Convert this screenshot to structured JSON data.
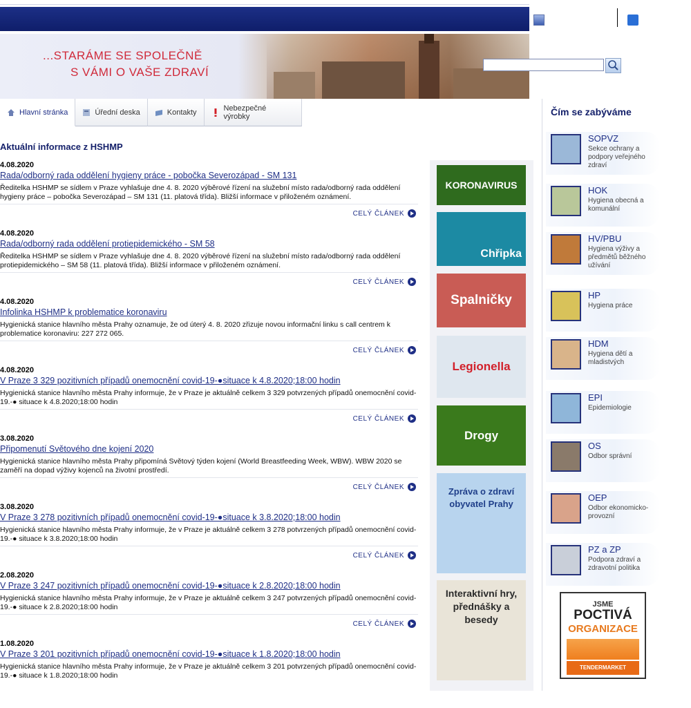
{
  "header": {
    "slogan_line1": "...STARÁME SE SPOLEČNĚ",
    "slogan_line2": "S VÁMI O VAŠE ZDRAVÍ",
    "search_value": "",
    "rss_glyph": "RSS"
  },
  "tabs": [
    {
      "label": "Hlavní stránka",
      "icon": "home-icon",
      "active": true
    },
    {
      "label": "Úřední deska",
      "icon": "board-icon",
      "active": false
    },
    {
      "label": "Kontakty",
      "icon": "contacts-icon",
      "active": false
    },
    {
      "label": "Nebezpečné výrobky",
      "icon": "warning-icon",
      "active": false
    }
  ],
  "main": {
    "section_title": "Aktuální informace z HSHMP",
    "more_label": "CELÝ ČLÁNEK",
    "news": [
      {
        "date": "4.08.2020",
        "title": "Rada/odborný rada oddělení hygieny práce - pobočka Severozápad - SM 131",
        "desc": "Ředitelka HSHMP se sídlem v Praze vyhlašuje dne 4. 8. 2020 výběrové řízení na služební místo rada/odborný rada oddělení hygieny práce – pobočka Severozápad – SM 131 (11. platová třída). Bližší informace v přiloženém oznámení."
      },
      {
        "date": "4.08.2020",
        "title": "Rada/odborný rada oddělení protiepidemického - SM 58",
        "desc": "Ředitelka HSHMP se sídlem v Praze vyhlašuje dne 4. 8. 2020 výběrové řízení na služební místo rada/odborný rada oddělení protiepidemického – SM 58 (11. platová třída). Bližší informace v přiloženém oznámení."
      },
      {
        "date": "4.08.2020",
        "title": "Infolinka HSHMP k problematice koronaviru",
        "desc": "Hygienická stanice hlavního města Prahy oznamuje, že od úterý 4. 8. 2020 zřizuje novou informační linku s call centrem k problematice koronaviru: 227 272 065."
      },
      {
        "date": "4.08.2020",
        "title": "V Praze 3 329 pozitivních případů onemocnění covid-19-●situace k 4.8.2020;18:00 hodin",
        "desc": "Hygienická stanice hlavního města Prahy informuje, že v Praze je aktuálně celkem 3 329 potvrzených případů onemocnění covid-19.-● situace k 4.8.2020;18:00 hodin"
      },
      {
        "date": "3.08.2020",
        "title": "Připomenutí Světového dne kojení 2020",
        "desc": "Hygienická stanice hlavního města Prahy připomíná Světový týden kojení (World Breastfeeding Week, WBW). WBW 2020 se zaměří na dopad výživy kojenců na životní prostředí."
      },
      {
        "date": "3.08.2020",
        "title": "V Praze 3 278 pozitivních případů onemocnění covid-19-●situace k 3.8.2020;18:00 hodin",
        "desc": "Hygienická stanice hlavního města Prahy informuje, že v Praze je aktuálně celkem 3 278 potvrzených případů onemocnění covid-19.-● situace k 3.8.2020;18:00 hodin"
      },
      {
        "date": "2.08.2020",
        "title": "V Praze 3 247 pozitivních případů onemocnění covid-19-●situace k 2.8.2020;18:00 hodin",
        "desc": "Hygienická stanice hlavního města Prahy informuje, že v Praze je aktuálně celkem 3 247 potvrzených případů onemocnění covid-19.-● situace k 2.8.2020;18:00 hodin"
      },
      {
        "date": "1.08.2020",
        "title": "V Praze 3 201 pozitivních případů onemocnění covid-19-●situace k 1.8.2020;18:00 hodin",
        "desc": "Hygienická stanice hlavního města Prahy informuje, že v Praze je aktuálně celkem 3 201 potvrzených případů onemocnění covid-19.-● situace k 1.8.2020;18:00 hodin"
      }
    ]
  },
  "promos": [
    {
      "label": "KORONAVIRUS",
      "bg": "#2f6b1e",
      "color": "#ffffff"
    },
    {
      "label": "Chřipka",
      "bg": "#1c8aa3",
      "color": "#ffffff"
    },
    {
      "label": "Spalničky",
      "bg": "#c95c55",
      "color": "#ffffff"
    },
    {
      "label": "Legionella",
      "bg": "#dfe7ef",
      "color": "#d2202a"
    },
    {
      "label": "Drogy",
      "bg": "#3a7a1c",
      "color": "#ffffff"
    },
    {
      "label": "Zpráva o zdraví obyvatel Prahy",
      "bg": "#b8d4ee",
      "color": "#1f3f8a"
    },
    {
      "label": "Interaktivní hry, přednášky a besedy",
      "bg": "#e9e4d8",
      "color": "#2a2a2a"
    }
  ],
  "sidebar": {
    "title": "Čím se zabýváme",
    "items": [
      {
        "code": "SOPVZ",
        "name": "Sekce ochrany a podpory veřejného zdraví",
        "thumb": "#9bb8d8"
      },
      {
        "code": "HOK",
        "name": "Hygiena obecná a komunální",
        "thumb": "#b9c79a"
      },
      {
        "code": "HV/PBU",
        "name": "Hygiena výživy a předmětů běžného užívání",
        "thumb": "#c07a3a"
      },
      {
        "code": "HP",
        "name": "Hygiena práce",
        "thumb": "#d8c25a"
      },
      {
        "code": "HDM",
        "name": "Hygiena dětí a mladistvých",
        "thumb": "#d9b48a"
      },
      {
        "code": "EPI",
        "name": "Epidemiologie",
        "thumb": "#8fb6d9"
      },
      {
        "code": "OS",
        "name": "Odbor správní",
        "thumb": "#8a7a6a"
      },
      {
        "code": "OEP",
        "name": "Odbor ekonomicko-provozní",
        "thumb": "#d9a38a"
      },
      {
        "code": "PZ a ZP",
        "name": "Podpora zdraví a zdravotní politika",
        "thumb": "#c9cfd9"
      }
    ]
  },
  "badge": {
    "line1": "JSME",
    "line2": "POCTIVÁ",
    "line3": "ORGANIZACE",
    "bar": "TENDERMARKET"
  }
}
